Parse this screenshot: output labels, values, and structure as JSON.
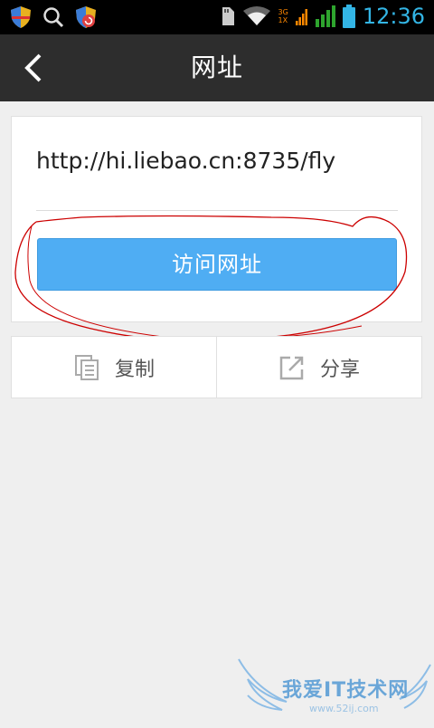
{
  "status_bar": {
    "time": "12:36",
    "net_top": "3G",
    "net_bottom": "1X"
  },
  "header": {
    "title": "网址"
  },
  "url_card": {
    "url": "http://hi.liebao.cn:8735/fly",
    "visit_button": "访问网址"
  },
  "actions": {
    "copy": "复制",
    "share": "分享"
  },
  "watermark": {
    "text": "我爱IT技术网",
    "url": "www.52ij.com"
  },
  "colors": {
    "button": "#4fadf3",
    "titlebar": "#2d2d2d",
    "status_accent": "#33b5e5",
    "annotation": "#cc0000"
  }
}
